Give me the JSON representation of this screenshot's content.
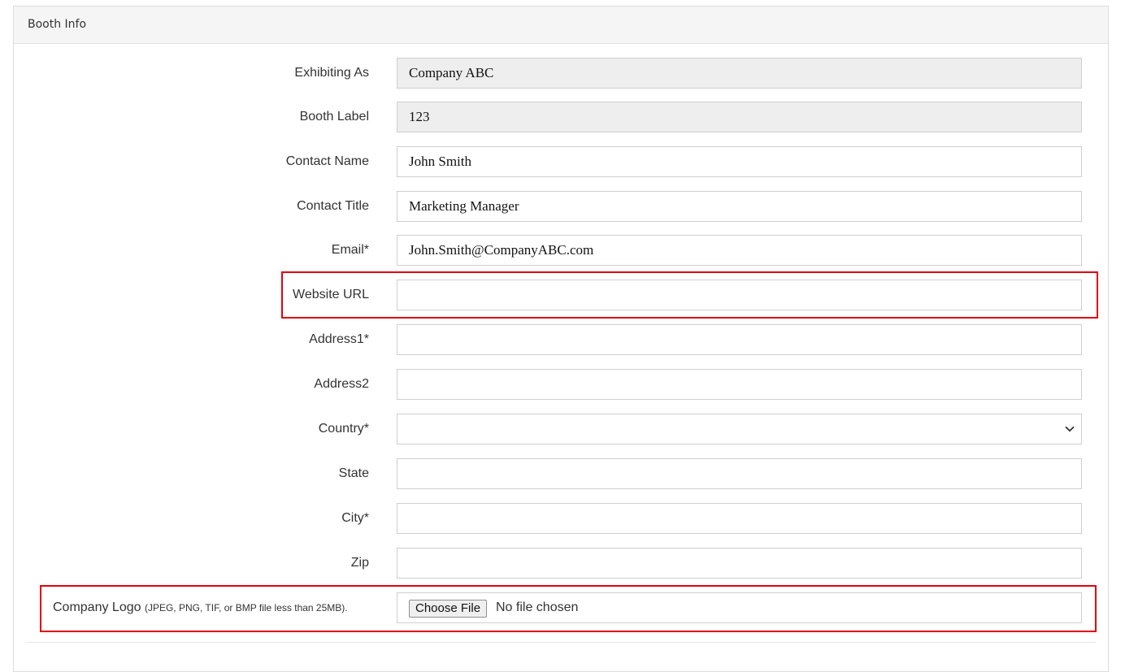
{
  "panel": {
    "title": "Booth Info"
  },
  "fields": {
    "exhibiting_as": {
      "label": "Exhibiting As",
      "value": "Company ABC"
    },
    "booth_label": {
      "label": "Booth Label",
      "value": "123"
    },
    "contact_name": {
      "label": "Contact Name",
      "value": "John Smith"
    },
    "contact_title": {
      "label": "Contact Title",
      "value": "Marketing Manager"
    },
    "email": {
      "label": "Email*",
      "value": "John.Smith@CompanyABC.com"
    },
    "website_url": {
      "label": "Website URL",
      "value": ""
    },
    "address1": {
      "label": "Address1*",
      "value": ""
    },
    "address2": {
      "label": "Address2",
      "value": ""
    },
    "country": {
      "label": "Country*",
      "value": ""
    },
    "state": {
      "label": "State",
      "value": ""
    },
    "city": {
      "label": "City*",
      "value": ""
    },
    "zip": {
      "label": "Zip",
      "value": ""
    }
  },
  "company_logo": {
    "label": "Company Logo",
    "hint": "(JPEG, PNG, TIF, or BMP file less than 25MB).",
    "button_label": "Choose File",
    "status": "No file chosen"
  },
  "colors": {
    "highlight": "#e3000f",
    "readonly_bg": "#eeeeee",
    "header_bg": "#f5f5f5"
  },
  "icons": {
    "country_dropdown": "chevron-down-icon"
  }
}
